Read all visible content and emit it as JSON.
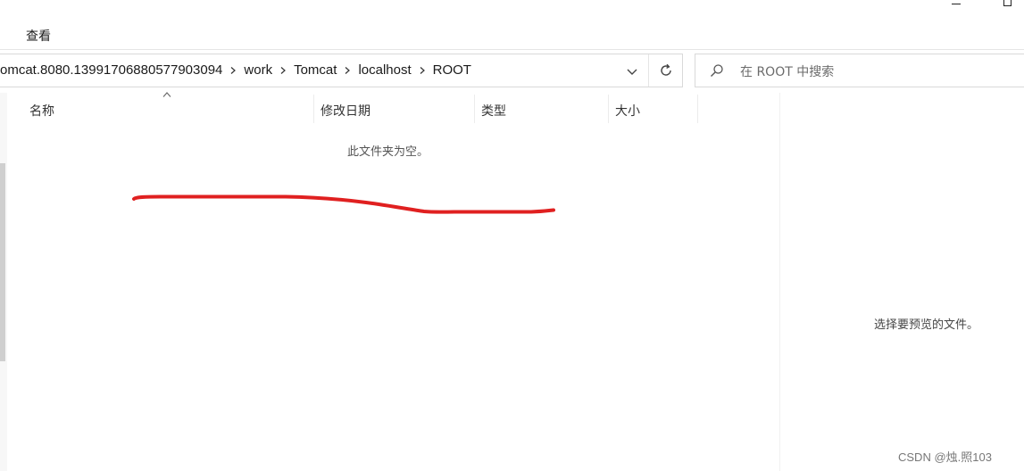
{
  "ribbon": {
    "view_tab": "查看"
  },
  "address_bar": {
    "crumbs": [
      "omcat.8080.13991706880577903094",
      "work",
      "Tomcat",
      "localhost",
      "ROOT"
    ]
  },
  "search": {
    "placeholder": "在 ROOT 中搜索"
  },
  "columns": {
    "name": "名称",
    "date": "修改日期",
    "type": "类型",
    "size": "大小"
  },
  "file_list": {
    "empty_message": "此文件夹为空。"
  },
  "preview": {
    "message": "选择要预览的文件。"
  },
  "watermark": "CSDN @烛.照103",
  "colors": {
    "annotation_stroke": "#e02020"
  },
  "icons": [
    "chevron-right-icon",
    "chevron-down-icon",
    "refresh-icon",
    "search-icon",
    "sort-ascending-icon"
  ]
}
